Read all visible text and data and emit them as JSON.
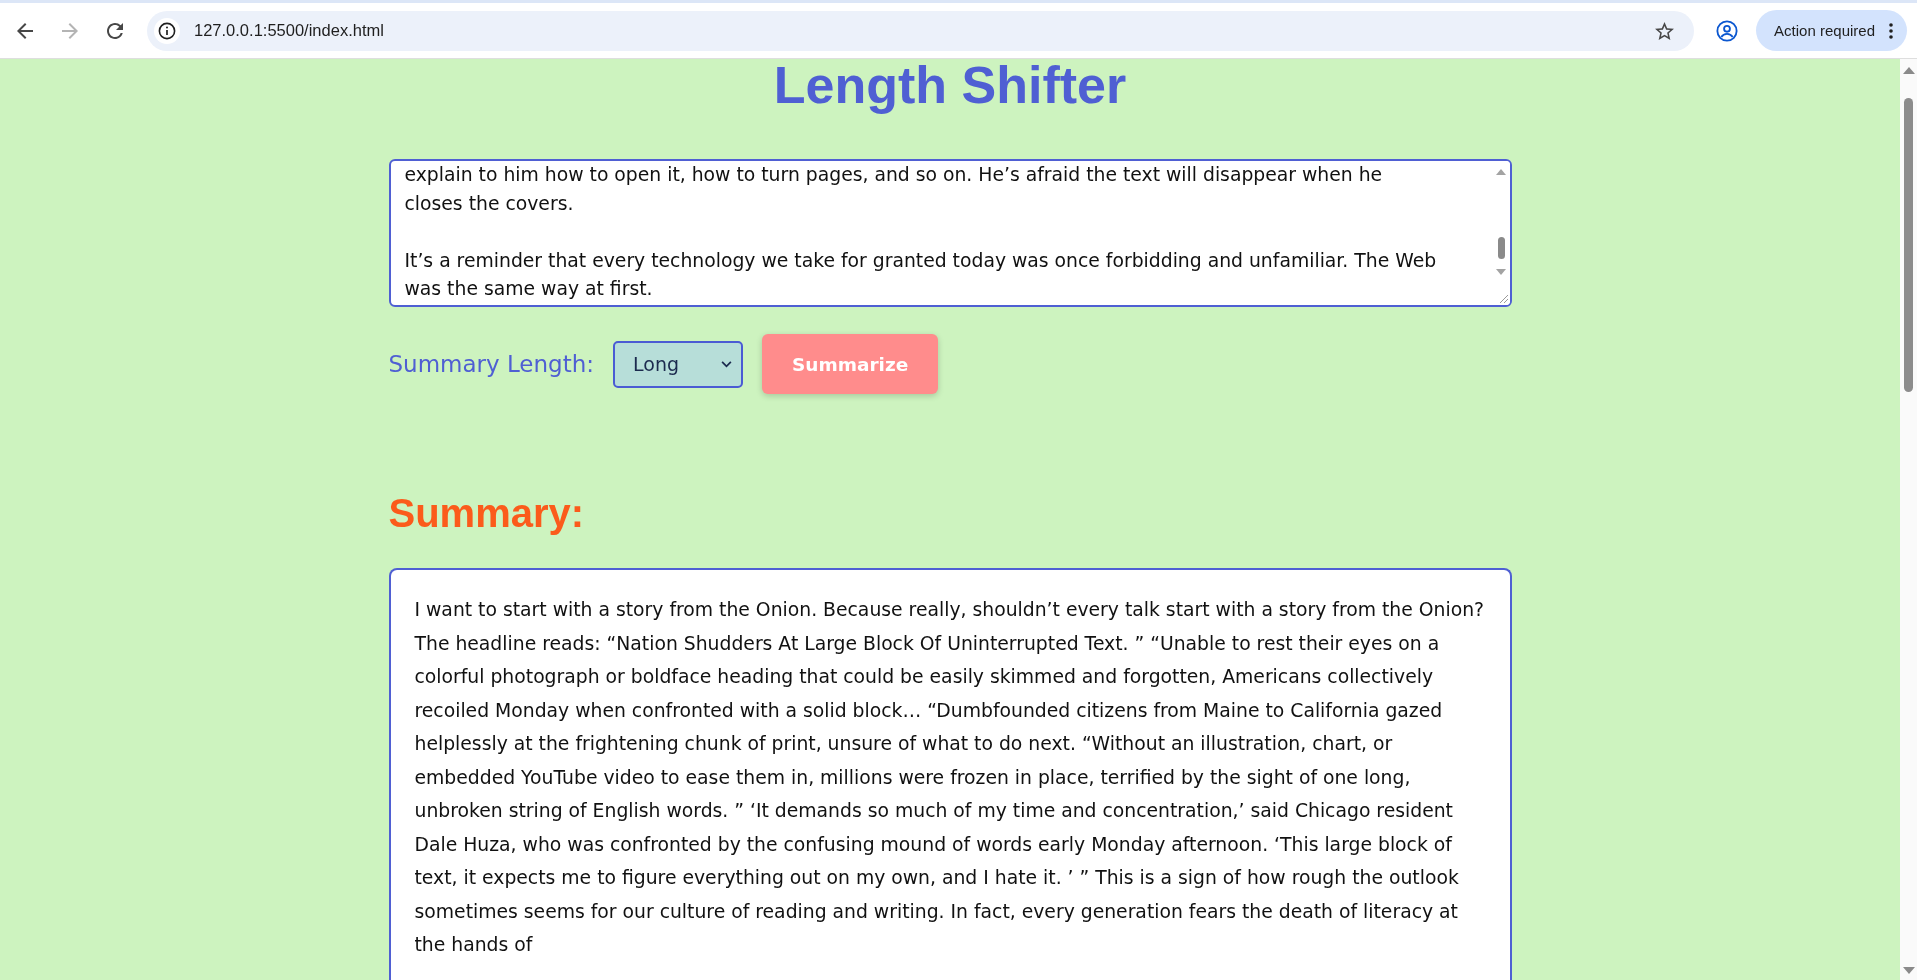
{
  "browser": {
    "nav_buttons": [
      {
        "kind": "back",
        "disabled": false
      },
      {
        "kind": "forward",
        "disabled": true
      },
      {
        "kind": "reload",
        "disabled": false
      }
    ],
    "url": "127.0.0.1:5500/index.html",
    "action_button": "Action required"
  },
  "page": {
    "title": "Length Shifter",
    "input": {
      "value": "explain to him how to open it, how to turn pages, and so on. He’s afraid the text will disappear when he closes the covers.\n\nIt’s a reminder that every technology we take for granted today was once forbidding and unfamiliar. The Web was the same way at first."
    },
    "length_control": {
      "label": "Summary Length:",
      "value": "Long"
    },
    "summarize_button": "Summarize",
    "summary": {
      "heading": "Summary:",
      "text": "I want to start with a story from the Onion. Because really, shouldn’t every talk start with a story from the Onion? The headline reads: “Nation Shudders At Large Block Of Uninterrupted Text. ” “Unable to rest their eyes on a colorful photograph or boldface heading that could be easily skimmed and forgotten, Americans collectively recoiled Monday when confronted with a solid block… “Dumbfounded citizens from Maine to California gazed helplessly at the frightening chunk of print, unsure of what to do next. “Without an illustration, chart, or embedded YouTube video to ease them in, millions were frozen in place, terrified by the sight of one long, unbroken string of English words. ” ‘It demands so much of my time and concentration,’ said Chicago resident Dale Huza, who was confronted by the confusing mound of words early Monday afternoon. ‘This large block of text, it expects me to figure everything out on my own, and I hate it. ’ ” This is a sign of how rough the outlook sometimes seems for our culture of reading and writing. In fact, every generation fears the death of literacy at the hands of"
    }
  }
}
